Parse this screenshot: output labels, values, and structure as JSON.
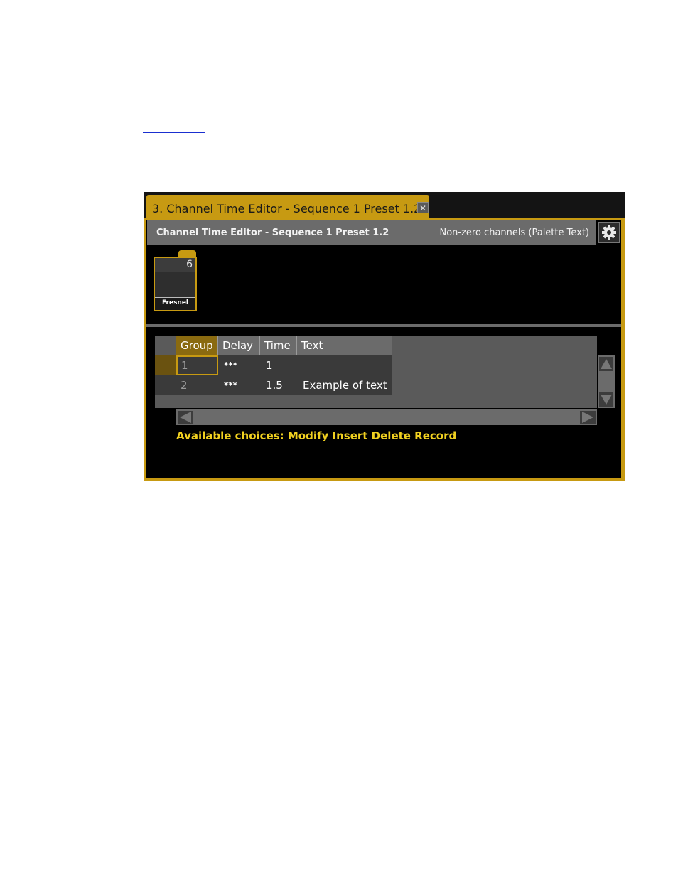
{
  "window": {
    "tab_title": "3. Channel Time Editor - Sequence 1 Preset 1.2",
    "close_glyph": "✕",
    "header_title": "Channel Time Editor - Sequence 1 Preset 1.2",
    "header_mode": "Non-zero channels (Palette Text)",
    "settings_icon": "gear-icon"
  },
  "channel_tile": {
    "number": "6",
    "label": "Fresnel"
  },
  "table": {
    "columns": [
      "Group",
      "Delay",
      "Time",
      "Text"
    ],
    "rows": [
      {
        "group": "1",
        "delay": "***",
        "time": "1",
        "text": ""
      },
      {
        "group": "2",
        "delay": "***",
        "time": "1.5",
        "text": "Example of text"
      }
    ]
  },
  "status": {
    "choices": "Available choices: Modify Insert Delete Record"
  },
  "colors": {
    "accent": "#c79a12",
    "status_text": "#f0d020",
    "background": "#000000"
  }
}
